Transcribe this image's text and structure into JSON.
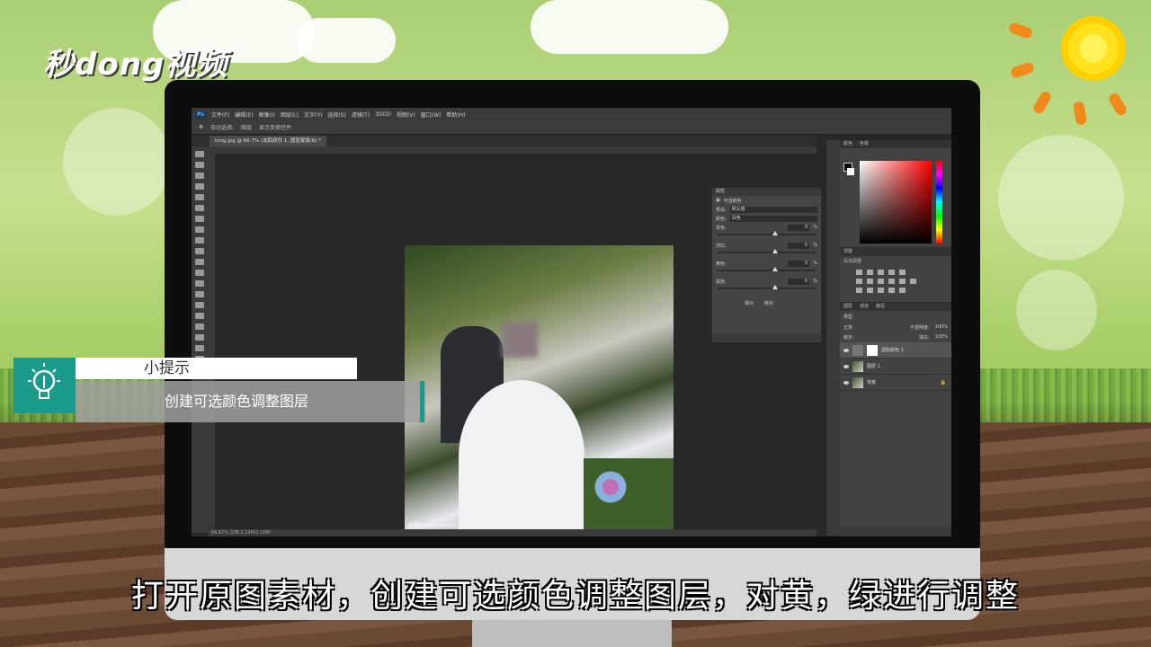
{
  "brand": {
    "logo_text": "秒dong视频"
  },
  "photoshop": {
    "menu": [
      "Ps",
      "文件(F)",
      "编辑(E)",
      "图像(I)",
      "图层(L)",
      "文字(Y)",
      "选择(S)",
      "滤镜(T)",
      "3D(D)",
      "视图(V)",
      "窗口(W)",
      "帮助(H)"
    ],
    "options_bar": {
      "auto_select": "自动选择:",
      "group": "图层",
      "transform": "显示变换控件"
    },
    "document_tab": "timg.jpg @ 66.7% (选取颜色 1, 图层蒙版/8) *",
    "status": "66.67%   文档:2.10M/2.10M",
    "photo_caption": "新图网 www.nipic.com",
    "properties": {
      "title": "属性",
      "subtitle": "可选颜色",
      "preset_label": "预设:",
      "preset_value": "默认值",
      "colors_label": "颜色:",
      "colors_value": "白色",
      "sliders": [
        {
          "label": "青色:",
          "value": "0",
          "unit": "%"
        },
        {
          "label": "洋红:",
          "value": "0",
          "unit": "%"
        },
        {
          "label": "黄色:",
          "value": "0",
          "unit": "%"
        },
        {
          "label": "黑色:",
          "value": "0",
          "unit": "%"
        }
      ],
      "mode_relative": "相对",
      "mode_absolute": "绝对"
    },
    "color_panel": {
      "tab_color": "颜色",
      "tab_swatch": "色板"
    },
    "adjustments": {
      "title": "调整",
      "subtitle": "添加调整"
    },
    "layers_panel": {
      "tabs": [
        "图层",
        "通道",
        "路径"
      ],
      "kind": "类型",
      "blend": "正常",
      "opacity_label": "不透明度:",
      "opacity": "100%",
      "lock_label": "锁定:",
      "fill_label": "填充:",
      "fill": "100%",
      "layers": [
        {
          "name": "选取颜色 1",
          "active": true
        },
        {
          "name": "图层 1",
          "active": false
        },
        {
          "name": "背景",
          "active": false
        }
      ]
    }
  },
  "tip": {
    "title": "小提示",
    "body": "创建可选颜色调整图层"
  },
  "subtitle": "打开原图素材，创建可选颜色调整图层，对黄，绿进行调整"
}
